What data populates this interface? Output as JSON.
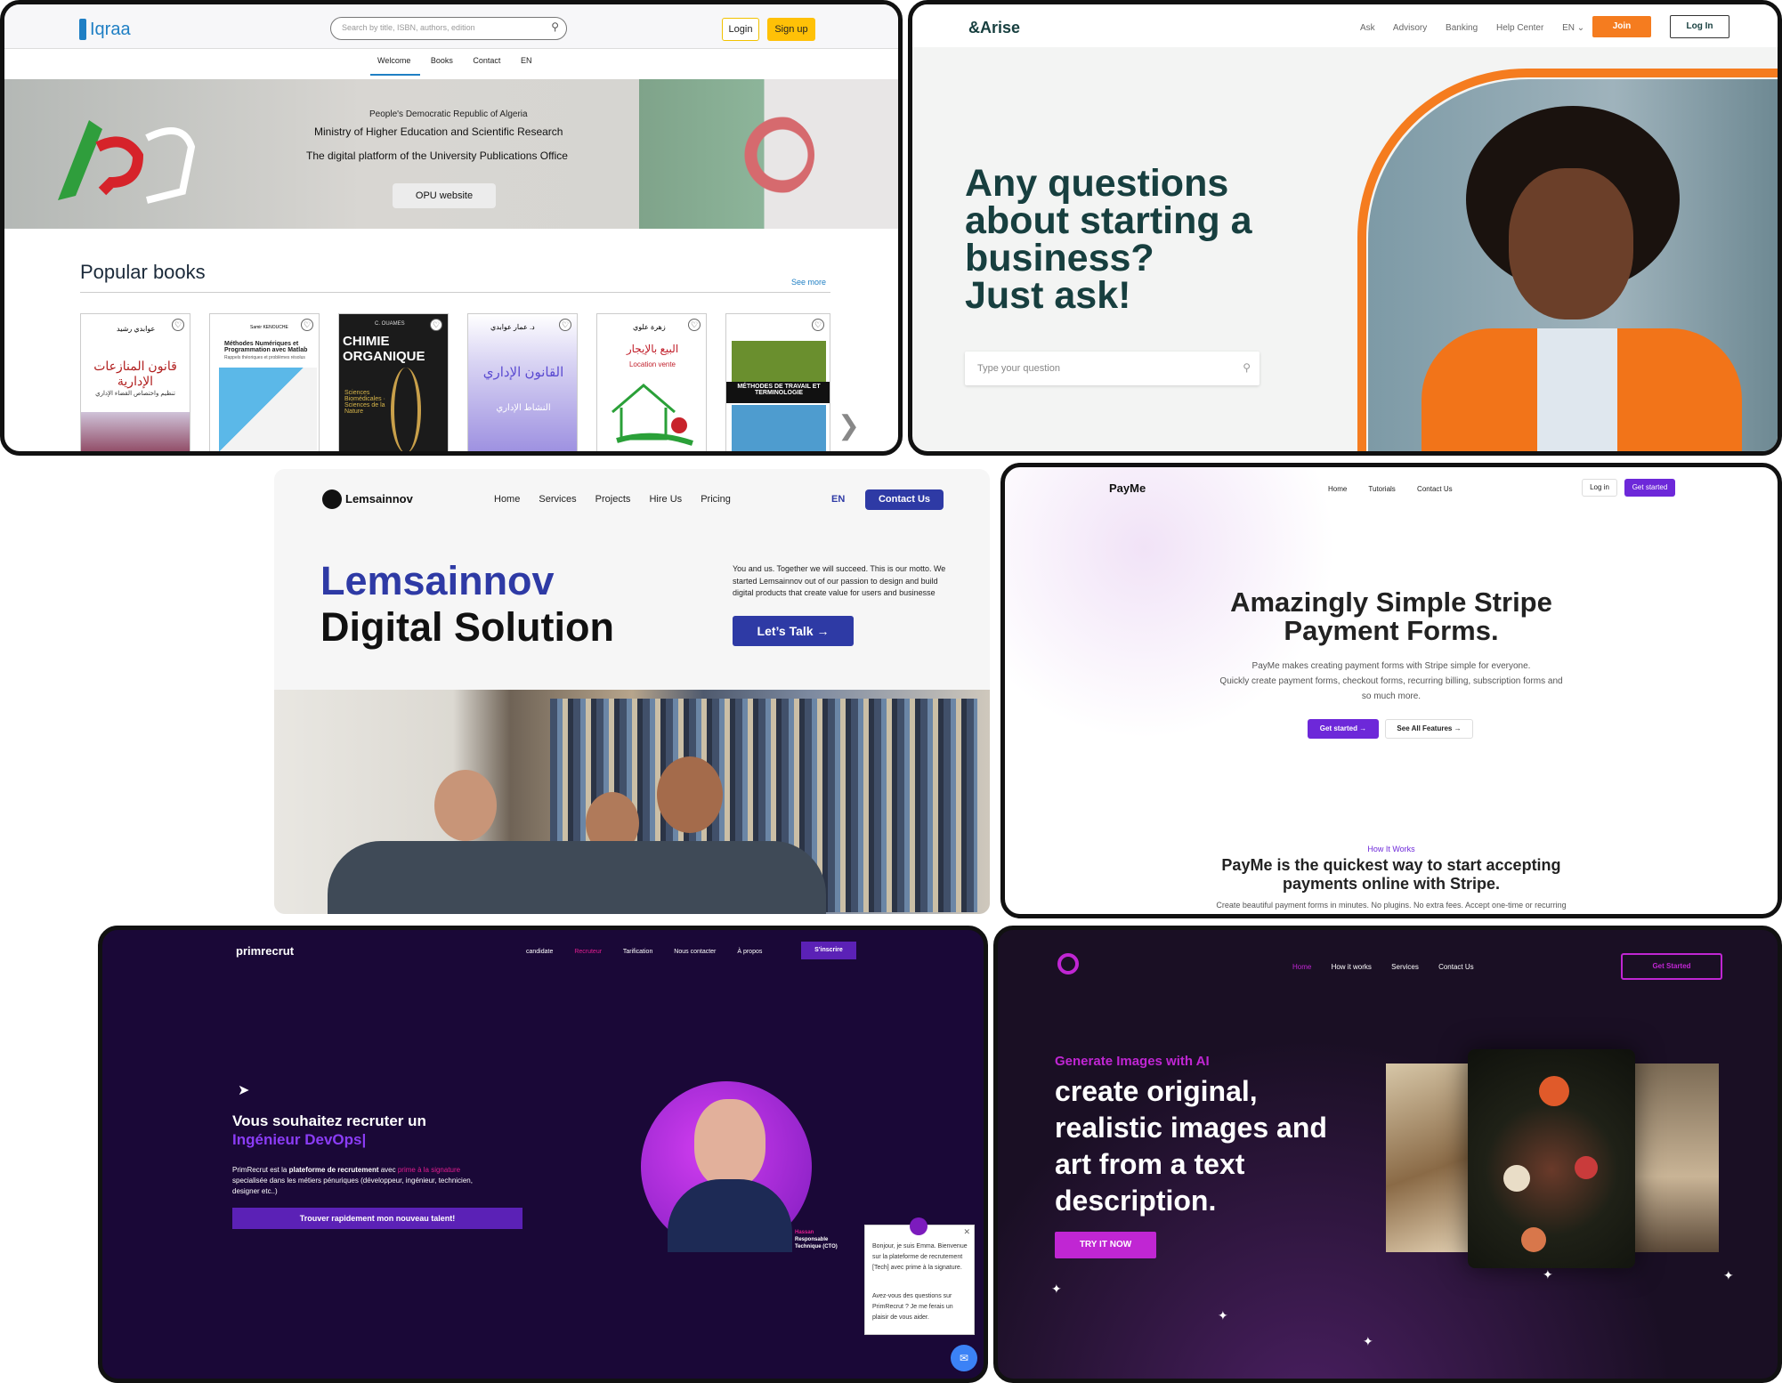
{
  "iqraa": {
    "logo": "Iqraa",
    "search_placeholder": "Search by title, ISBN, authors, edition",
    "login": "Login",
    "signup": "Sign up",
    "nav": [
      "Welcome",
      "Books",
      "Contact",
      "EN"
    ],
    "hero_line1": "People's Democratic Republic of Algeria",
    "hero_line2": "Ministry of Higher Education and Scientific Research",
    "hero_line3": "The digital platform of the University Publications Office",
    "hero_button": "OPU website",
    "section_title": "Popular books",
    "see_more": "See more",
    "books": [
      {
        "title": "قانون المنازعات الإدارية",
        "author": "عوابدي رشيد",
        "subtitle": "تنظيم واختصاص القضاء الإداري"
      },
      {
        "title": "Méthodes Numériques et Programmation avec Matlab",
        "author": "Samir KENOUCHE",
        "subtitle": "Rappels théoriques et problèmes résolus"
      },
      {
        "title": "CHIMIE ORGANIQUE",
        "author": "C. OUAMES",
        "subtitle": "Sciences Biomédicales · Sciences de la Nature"
      },
      {
        "title": "القانون الإداري",
        "author": "د. عمار عوابدي",
        "subtitle": "النشاط الإداري"
      },
      {
        "title": "البيع بالإيجار",
        "author": "زهرة علوي",
        "subtitle": "Location vente"
      },
      {
        "title": "MÉTHODES DE TRAVAIL ET TERMINOLOGIE",
        "author": "",
        "subtitle": ""
      }
    ]
  },
  "arise": {
    "logo": "&Arise",
    "nav": [
      "Ask",
      "Advisory",
      "Banking",
      "Help Center",
      "EN"
    ],
    "join": "Join",
    "login": "Log In",
    "headline": [
      "Any questions",
      "about starting a",
      "business?",
      "Just ask!"
    ],
    "placeholder": "Type your question",
    "colors": {
      "accent": "#f57c1f",
      "text": "#173f3f"
    }
  },
  "lems": {
    "logo": "Lemsainnov",
    "nav": [
      "Home",
      "Services",
      "Projects",
      "Hire Us",
      "Pricing"
    ],
    "lang": "EN",
    "contact": "Contact Us",
    "title1": "Lemsainnov",
    "title2": "Digital Solution",
    "desc": "You and us. Together we will succeed. This is our motto. We started Lemsainnov out of our passion to design and build digital products that create value for users and businesse",
    "cta": "Let’s Talk",
    "colors": {
      "accent": "#2e3aa5"
    }
  },
  "payme": {
    "logo": "PayMe",
    "nav": [
      "Home",
      "Tutorials",
      "Contact Us"
    ],
    "login": "Log in",
    "started": "Get started",
    "h1": "Amazingly Simple Stripe",
    "h2": "Payment Forms.",
    "sub1": "PayMe makes creating payment forms with Stripe simple for everyone.",
    "sub2": "Quickly create payment forms, checkout forms, recurring billing, subscription forms and",
    "sub3": "so much more.",
    "cta1": "Get started",
    "cta2": "See All Features",
    "how": "How It Works",
    "q1": "PayMe is the quickest way to start accepting",
    "q2": "payments online with Stripe.",
    "foot": "Create beautiful payment forms in minutes. No plugins. No extra fees. Accept one-time or recurring",
    "colors": {
      "accent": "#6d28d9"
    }
  },
  "prim": {
    "logo": "primrecrut",
    "nav": [
      "candidate",
      "Recruteur",
      "Tarification",
      "Nous contacter",
      "À propos"
    ],
    "signup": "S'inscrire",
    "h1": "Vous souhaitez recruter un",
    "h2": "Ingénieur DevOps|",
    "p_a": "PrimRecrut est la ",
    "p_b": "plateforme de recrutement",
    "p_c": " avec ",
    "p_d": "prime à la signature",
    "p_e": "specialisée dans les métiers pénuriques (développeur, ingénieur, technicien, designer etc..)",
    "cta": "Trouver rapidement mon nouveau talent!",
    "person": "Hassan",
    "role1": "Responsable",
    "role2": "Technique (CTO)",
    "chat1": "Bonjour, je suis Emma. Bienvenue sur la plateforme de recrutement [Tech] avec prime à la signature.",
    "chat2": "Avez-vous des questions sur PrimRecrut ? Je me ferais un plaisir de vous aider.",
    "colors": {
      "bg": "#1a0837",
      "accent": "#5b21b6",
      "pink": "#e11d8f"
    }
  },
  "genai": {
    "nav": [
      "Home",
      "How it works",
      "Services",
      "Contact Us"
    ],
    "started": "Get Started",
    "eyebrow": "Generate Images with AI",
    "h": [
      "create original,",
      "realistic images and",
      "art from a text",
      "description."
    ],
    "cta": "TRY IT NOW",
    "colors": {
      "accent": "#c026d3",
      "bg": "#1a0f24"
    }
  }
}
